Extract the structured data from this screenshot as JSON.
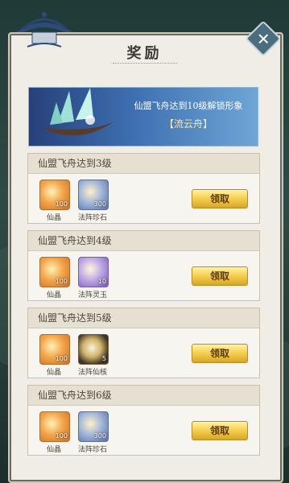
{
  "dialog": {
    "title": "奖励",
    "close_icon": "close-icon"
  },
  "banner": {
    "text": "仙盟飞舟达到10级解锁形象",
    "highlight": "【流云舟】"
  },
  "rewards": [
    {
      "header": "仙盟飞舟达到3级",
      "items": [
        {
          "label": "仙晶",
          "qty": "100",
          "style": "orange"
        },
        {
          "label": "法阵珍石",
          "qty": "300",
          "style": "blue"
        }
      ],
      "button": "领取"
    },
    {
      "header": "仙盟飞舟达到4级",
      "items": [
        {
          "label": "仙晶",
          "qty": "100",
          "style": "orange"
        },
        {
          "label": "法阵灵玉",
          "qty": "10",
          "style": "purple"
        }
      ],
      "button": "领取"
    },
    {
      "header": "仙盟飞舟达到5级",
      "items": [
        {
          "label": "仙晶",
          "qty": "100",
          "style": "orange"
        },
        {
          "label": "法阵仙核",
          "qty": "5",
          "style": "dark"
        }
      ],
      "button": "领取"
    },
    {
      "header": "仙盟飞舟达到6级",
      "items": [
        {
          "label": "仙晶",
          "qty": "100",
          "style": "orange"
        },
        {
          "label": "法阵珍石",
          "qty": "300",
          "style": "blue"
        }
      ],
      "button": "领取"
    }
  ],
  "colors": {
    "panel": "#efede6",
    "button_gold": "#f3c947",
    "banner_blue": "#3d6fb0"
  }
}
